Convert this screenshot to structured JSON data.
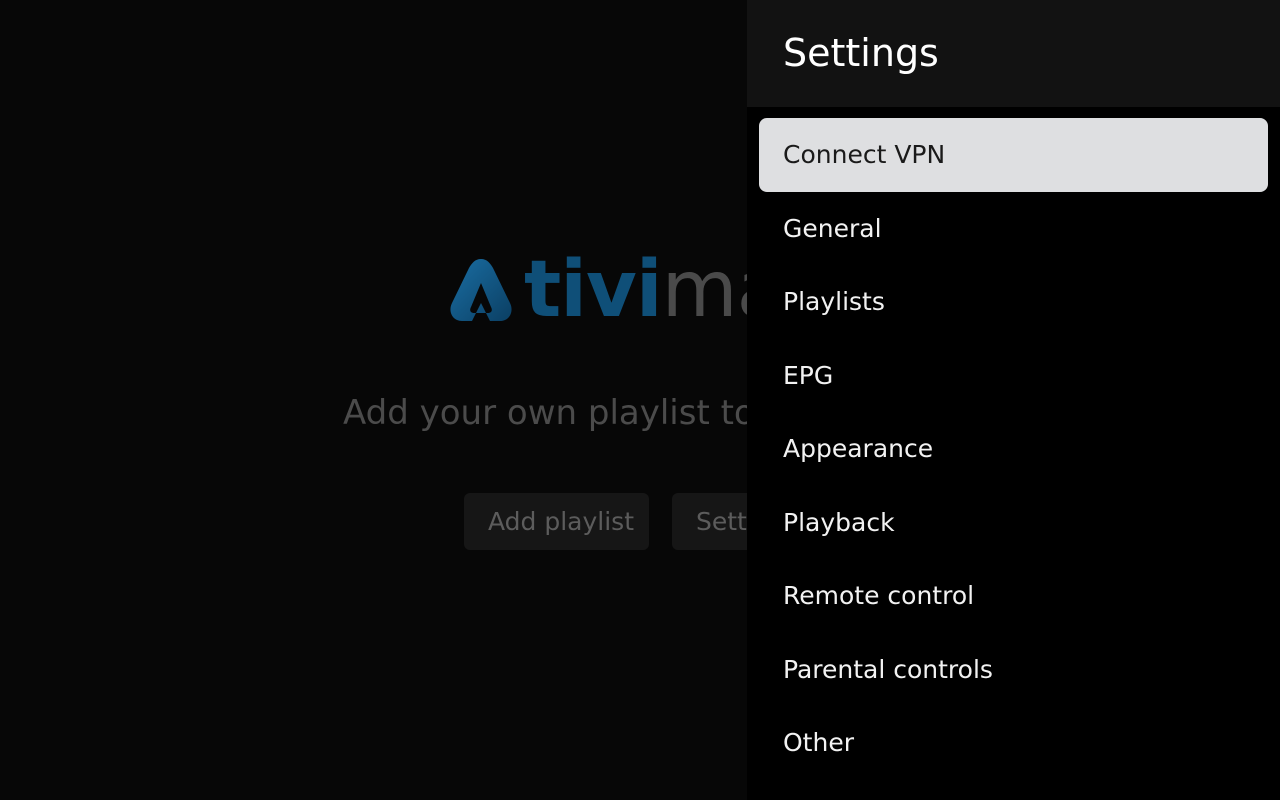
{
  "background": {
    "logo": {
      "part1": "tivi",
      "part2": "mate"
    },
    "tagline": "Add your own playlist to start",
    "add_playlist_label": "Add playlist",
    "settings_label": "Settings"
  },
  "settings_panel": {
    "title": "Settings",
    "items": [
      {
        "label": "Connect VPN",
        "focused": true
      },
      {
        "label": "General"
      },
      {
        "label": "Playlists"
      },
      {
        "label": "EPG"
      },
      {
        "label": "Appearance"
      },
      {
        "label": "Playback"
      },
      {
        "label": "Remote control"
      },
      {
        "label": "Parental controls"
      },
      {
        "label": "Other"
      }
    ]
  },
  "colors": {
    "logo_blue": "#0f4f78",
    "focused_item_bg": "#dedfe1",
    "header_bg": "#121212"
  }
}
